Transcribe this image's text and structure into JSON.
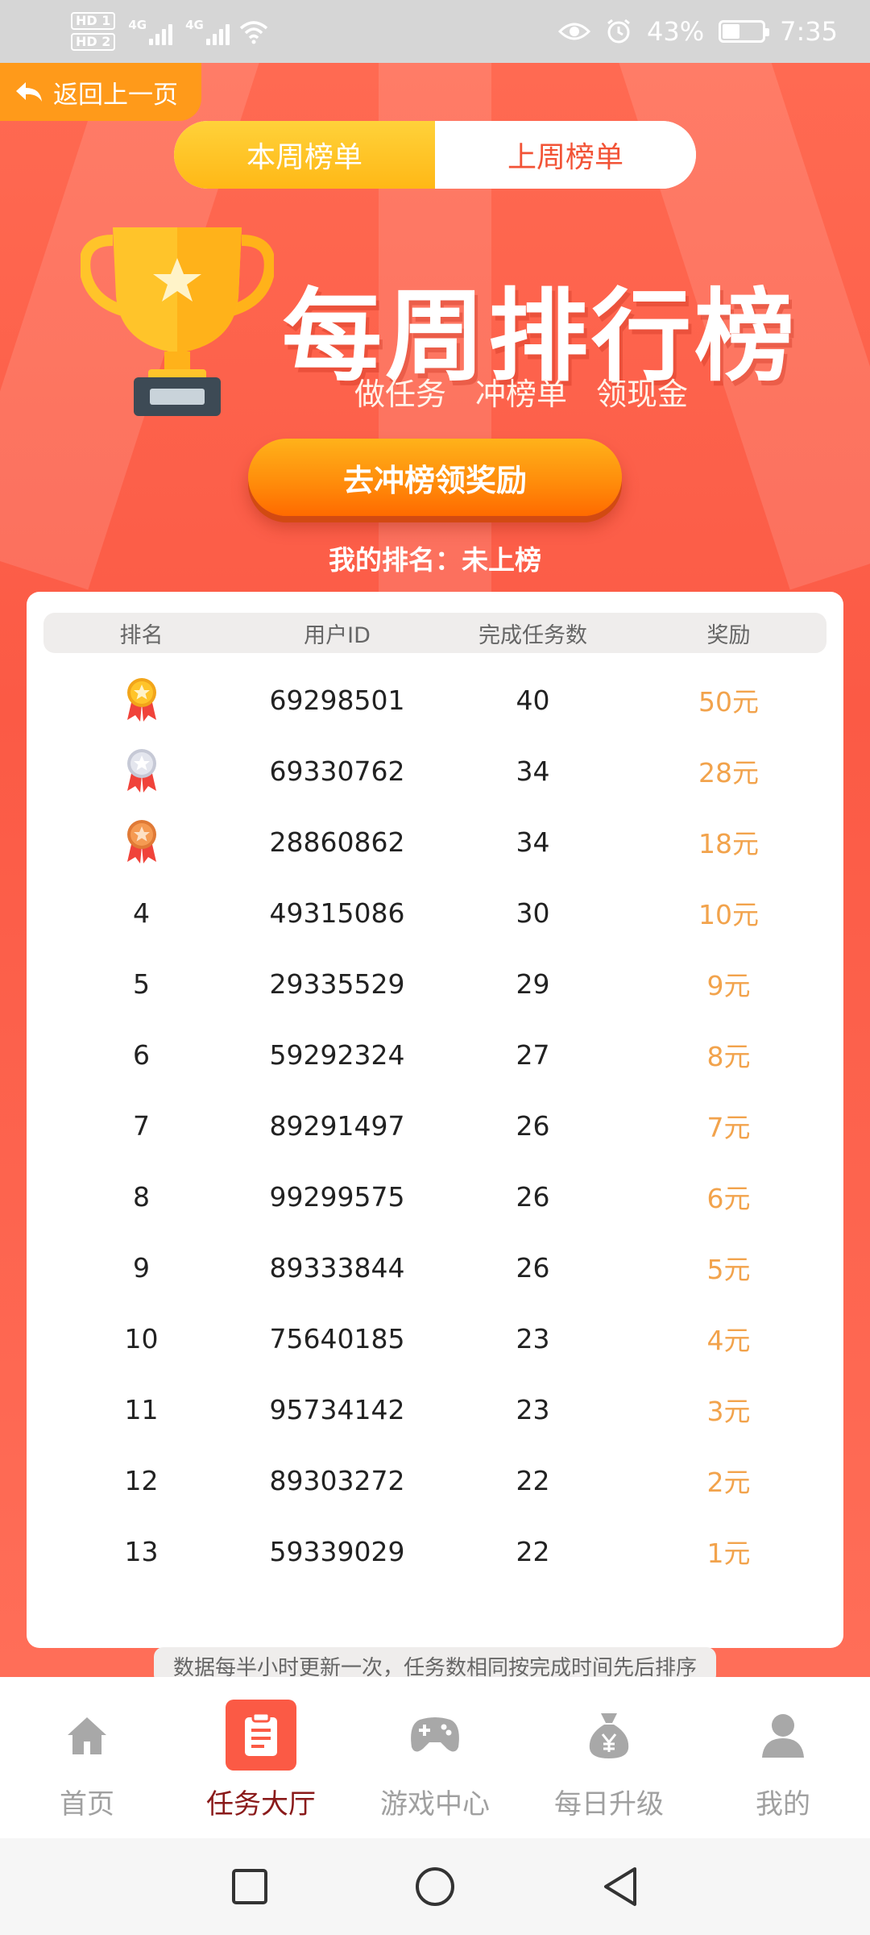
{
  "status_bar": {
    "sim1": "HD 1",
    "sim2": "HD 2",
    "net1": "4G",
    "net2": "4G",
    "battery": "43%",
    "time": "7:35"
  },
  "header": {
    "back_label": "返回上一页",
    "tabs": [
      {
        "label": "本周榜单",
        "active": true
      },
      {
        "label": "上周榜单",
        "active": false
      }
    ],
    "title": "每周排行榜",
    "slogans": [
      "做任务",
      "冲榜单",
      "领现金"
    ],
    "cta_label": "去冲榜领奖励",
    "my_rank": "我的排名：未上榜"
  },
  "leaderboard": {
    "columns": [
      "排名",
      "用户ID",
      "完成任务数",
      "奖励"
    ],
    "rows": [
      {
        "rank": "1",
        "medal": "gold",
        "user_id": "69298501",
        "tasks": "40",
        "reward": "50元"
      },
      {
        "rank": "2",
        "medal": "silver",
        "user_id": "69330762",
        "tasks": "34",
        "reward": "28元"
      },
      {
        "rank": "3",
        "medal": "bronze",
        "user_id": "28860862",
        "tasks": "34",
        "reward": "18元"
      },
      {
        "rank": "4",
        "medal": "",
        "user_id": "49315086",
        "tasks": "30",
        "reward": "10元"
      },
      {
        "rank": "5",
        "medal": "",
        "user_id": "29335529",
        "tasks": "29",
        "reward": "9元"
      },
      {
        "rank": "6",
        "medal": "",
        "user_id": "59292324",
        "tasks": "27",
        "reward": "8元"
      },
      {
        "rank": "7",
        "medal": "",
        "user_id": "89291497",
        "tasks": "26",
        "reward": "7元"
      },
      {
        "rank": "8",
        "medal": "",
        "user_id": "99299575",
        "tasks": "26",
        "reward": "6元"
      },
      {
        "rank": "9",
        "medal": "",
        "user_id": "89333844",
        "tasks": "26",
        "reward": "5元"
      },
      {
        "rank": "10",
        "medal": "",
        "user_id": "75640185",
        "tasks": "23",
        "reward": "4元"
      },
      {
        "rank": "11",
        "medal": "",
        "user_id": "95734142",
        "tasks": "23",
        "reward": "3元"
      },
      {
        "rank": "12",
        "medal": "",
        "user_id": "89303272",
        "tasks": "22",
        "reward": "2元"
      },
      {
        "rank": "13",
        "medal": "",
        "user_id": "59339029",
        "tasks": "22",
        "reward": "1元"
      }
    ],
    "note": "数据每半小时更新一次，任务数相同按完成时间先后排序"
  },
  "bottom_nav": [
    {
      "label": "首页",
      "icon": "home-icon",
      "active": false
    },
    {
      "label": "任务大厅",
      "icon": "clipboard-icon",
      "active": true
    },
    {
      "label": "游戏中心",
      "icon": "gamepad-icon",
      "active": false
    },
    {
      "label": "每日升级",
      "icon": "money-bag-icon",
      "active": false
    },
    {
      "label": "我的",
      "icon": "user-icon",
      "active": false
    }
  ],
  "colors": {
    "brand_red": "#fb5a45",
    "gold": "#ffc42a",
    "reward_orange": "#f2a34c",
    "active_nav_label": "#8a1a1a"
  }
}
